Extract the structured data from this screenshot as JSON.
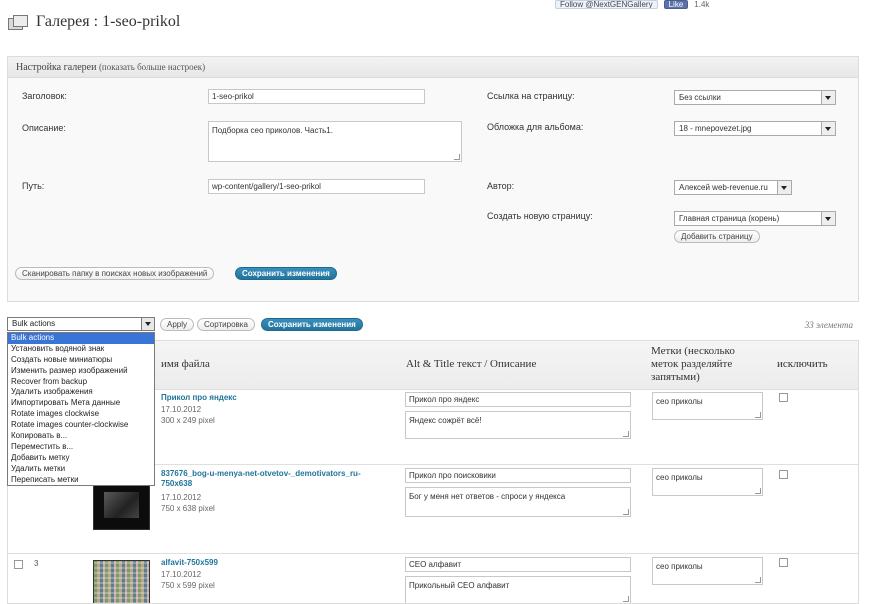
{
  "topbar": {
    "follow": "Follow @NextGENGallery",
    "like": "Like",
    "count": "1.4k"
  },
  "page": {
    "title": "Галерея : 1-seo-prikol"
  },
  "settings": {
    "heading": "Настройка галереи",
    "more_link": "(показать больше настроек)",
    "title_label": "Заголовок:",
    "title_value": "1-seo-prikol",
    "desc_label": "Описание:",
    "desc_value": "Подборка сео приколов. Часть1.",
    "path_label": "Путь:",
    "path_value": "wp-content/gallery/1-seo-prikol",
    "link_label": "Ссылка на страницу:",
    "link_value": "Без ссылки",
    "cover_label": "Обложка для альбома:",
    "cover_value": "18 - mnepovezet.jpg",
    "author_label": "Автор:",
    "author_value": "Алексей web-revenue.ru",
    "newpage_label": "Создать новую страницу:",
    "newpage_value": "Главная страница (корень)",
    "add_page_btn": "Добавить страницу",
    "scan_btn": "Сканировать папку в поисках новых изображений",
    "save_btn": "Сохранить изменения"
  },
  "actions": {
    "bulk_selected": "Bulk actions",
    "apply_btn": "Apply",
    "sort_btn": "Сортировка",
    "save_btn": "Сохранить изменения",
    "count": "33 элемента",
    "options": [
      "Bulk actions",
      "Установить водяной знак",
      "Создать новые миниатюры",
      "Изменить размер изображений",
      "Recover from backup",
      "Удалить изображения",
      "Импортировать Мета данные",
      "Rotate images clockwise",
      "Rotate images counter-clockwise",
      "Копировать в...",
      "Переместить в...",
      "Добавить метку",
      "Удалить метки",
      "Переписать метки"
    ]
  },
  "table": {
    "col_file": "имя файла",
    "col_alt": "Alt & Title текст / Описание",
    "col_tags": "Метки (несколько меток разделяйте запятыми)",
    "col_exclude": "исключить",
    "rows": [
      {
        "num": "",
        "file": "Прикол про яндекс",
        "date": "17.10.2012",
        "size": "300 x 249 pixel",
        "alt": "Прикол про яндекс",
        "desc": "Яндекс сожрёт всё!",
        "tags": "сео приколы"
      },
      {
        "num": "",
        "file": "837676_bog-u-menya-net-otvetov-_demotivators_ru-750x638",
        "date": "17.10.2012",
        "size": "750 x 638 pixel",
        "alt": "Прикол про поисковики",
        "desc": "Бог у меня нет ответов - спроси у яндекса",
        "tags": "сео приколы"
      },
      {
        "num": "3",
        "file": "alfavit-750x599",
        "date": "17.10.2012",
        "size": "750 x 599 pixel",
        "alt": "СЕО алфавит",
        "desc": "Прикольный СЕО алфавит",
        "tags": "сео приколы"
      }
    ]
  }
}
